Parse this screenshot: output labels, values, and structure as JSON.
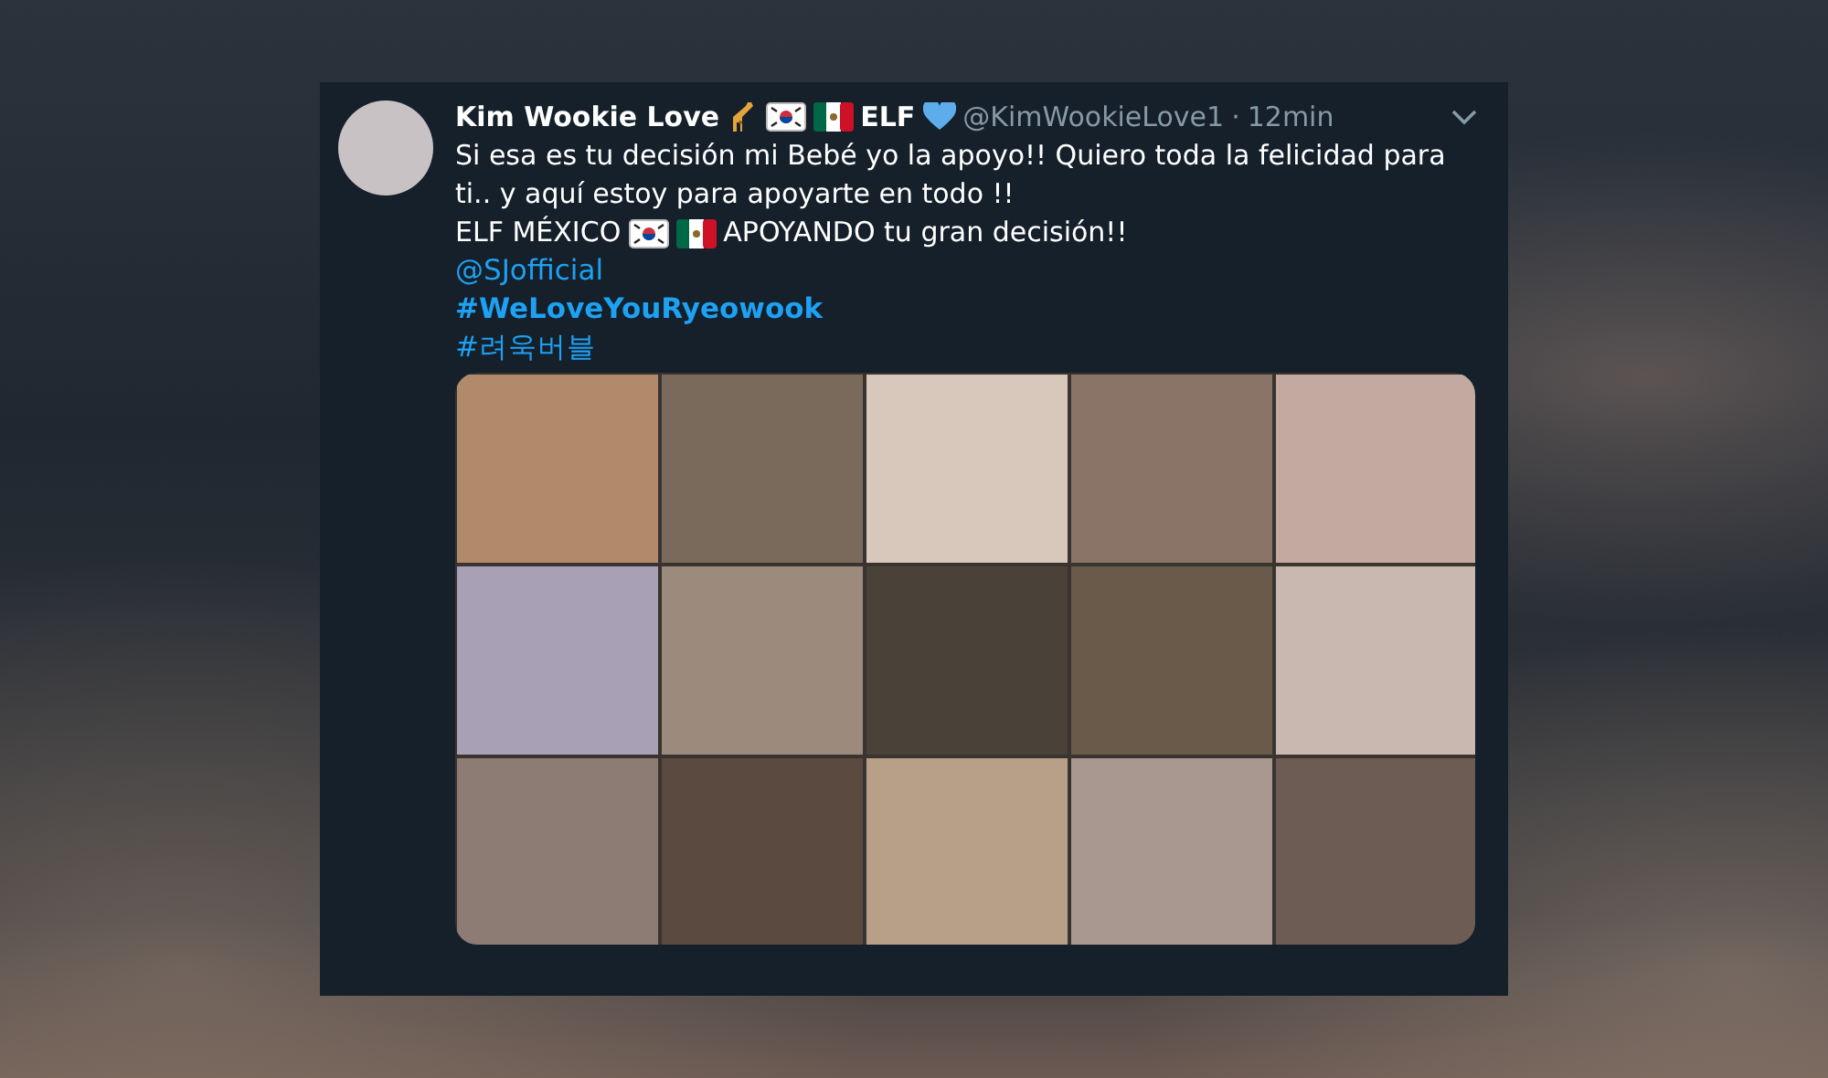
{
  "tweet": {
    "author_parts": [
      {
        "kind": "text",
        "text": "Kim Wookie Love"
      },
      {
        "kind": "giraffe"
      },
      {
        "kind": "flag_kr"
      },
      {
        "kind": "flag_mx"
      },
      {
        "kind": "text",
        "text": "ELF"
      },
      {
        "kind": "heart"
      }
    ],
    "handle": "@KimWookieLove1",
    "separator": "·",
    "time": "12min",
    "lines": [
      {
        "kind": "plain",
        "parts": [
          {
            "kind": "text",
            "text": "Si esa es tu decisión mi Bebé yo la apoyo!! Quiero toda la felicidad para ti.. y aquí estoy para apoyarte en todo !!"
          }
        ]
      },
      {
        "kind": "plain",
        "parts": [
          {
            "kind": "text",
            "text": "ELF MÉXICO"
          },
          {
            "kind": "flag_kr"
          },
          {
            "kind": "flag_mx"
          },
          {
            "kind": "text",
            "text": "APOYANDO tu gran decisión!!"
          }
        ]
      },
      {
        "kind": "mention",
        "parts": [
          {
            "kind": "text",
            "text": "@SJofficial"
          }
        ]
      },
      {
        "kind": "hashtag_bold",
        "parts": [
          {
            "kind": "text",
            "text": "#WeLoveYouRyeowook"
          }
        ]
      },
      {
        "kind": "hashtag",
        "parts": [
          {
            "kind": "text",
            "text": "#려욱버블"
          }
        ]
      }
    ]
  }
}
